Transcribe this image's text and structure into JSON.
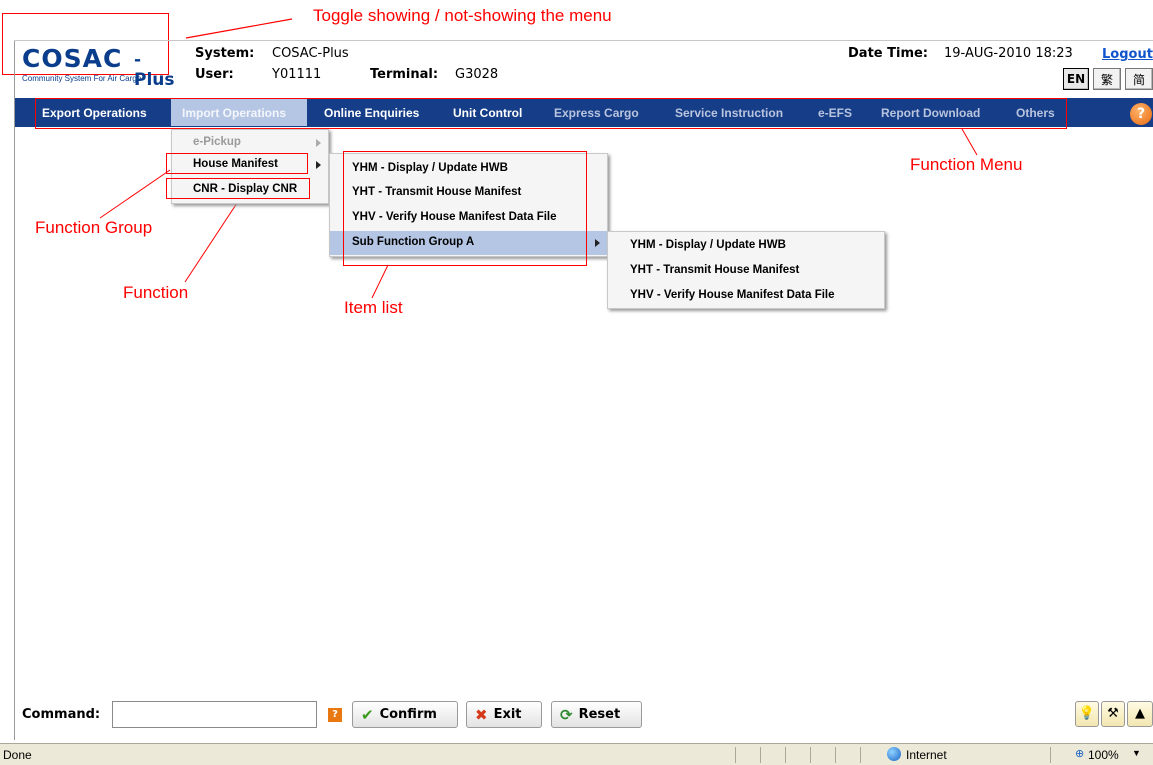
{
  "annotations": {
    "toggle": "Toggle showing / not-showing the menu",
    "function_menu": "Function Menu",
    "function_group": "Function Group",
    "function": "Function",
    "item_list": "Item list"
  },
  "header": {
    "logo_main": "COSAC",
    "logo_plus": "-Plus",
    "logo_sub": "Community System For Air Cargo",
    "system_label": "System:",
    "system_value": "COSAC-Plus",
    "user_label": "User:",
    "user_value": "Y01111",
    "terminal_label": "Terminal:",
    "terminal_value": "G3028",
    "datetime_label": "Date Time:",
    "datetime_value": "19-AUG-2010 18:23",
    "logout": "Logout",
    "languages": [
      "EN",
      "繁",
      "简"
    ]
  },
  "menu": {
    "items": [
      "Export Operations",
      "Import Operations",
      "Online Enquiries",
      "Unit Control",
      "Express Cargo",
      "Service Instruction",
      "e-EFS",
      "Report Download",
      "Others"
    ],
    "help": "?"
  },
  "dropdown1": [
    "e-Pickup",
    "House Manifest",
    "CNR - Display CNR"
  ],
  "dropdown2": [
    "YHM - Display / Update HWB",
    "YHT - Transmit House Manifest",
    "YHV - Verify House Manifest Data File",
    "Sub Function Group A"
  ],
  "dropdown3": [
    "YHM - Display / Update HWB",
    "YHT - Transmit House Manifest",
    "YHV - Verify House Manifest Data File"
  ],
  "command": {
    "label": "Command:",
    "value": "",
    "help": "?",
    "confirm": "Confirm",
    "exit": "Exit",
    "reset": "Reset"
  },
  "status": {
    "text": "Done",
    "zone": "Internet",
    "zoom": "100%"
  },
  "colors": {
    "menubar": "#163e88",
    "annotation": "#ff0000",
    "highlight": "#b4c6e4"
  }
}
